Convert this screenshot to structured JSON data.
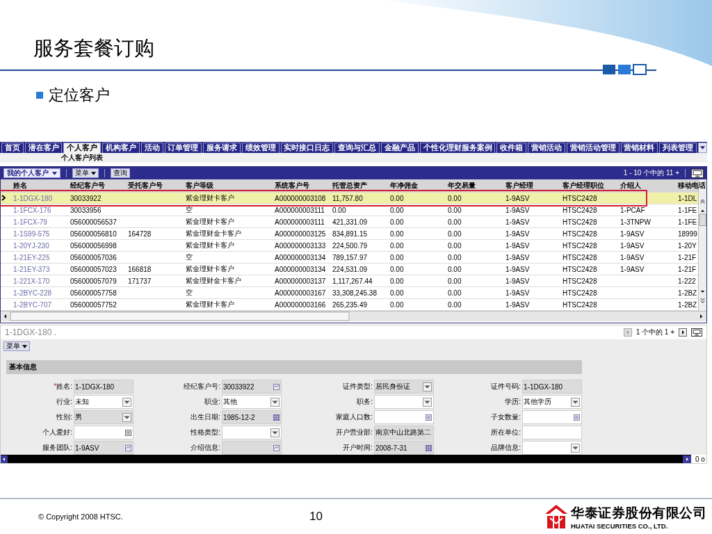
{
  "slide": {
    "title": "服务套餐订购",
    "bullet": "定位客户"
  },
  "app": {
    "tabs": [
      {
        "label": "首页",
        "selected": false
      },
      {
        "label": "潜在客户",
        "selected": false
      },
      {
        "label": "个人客户",
        "selected": true
      },
      {
        "label": "机构客户",
        "selected": false
      },
      {
        "label": "活动",
        "selected": false
      },
      {
        "label": "订单管理",
        "selected": false
      },
      {
        "label": "服务请求",
        "selected": false
      },
      {
        "label": "绩效管理",
        "selected": false
      },
      {
        "label": "实时接口日志",
        "selected": false
      },
      {
        "label": "查询与汇总",
        "selected": false
      },
      {
        "label": "金融产品",
        "selected": false
      },
      {
        "label": "个性化理财服务案例",
        "selected": false
      },
      {
        "label": "收件箱",
        "selected": false
      },
      {
        "label": "营销活动",
        "selected": false
      },
      {
        "label": "营销活动管理",
        "selected": false
      },
      {
        "label": "营销材料",
        "selected": false
      },
      {
        "label": "列表管理",
        "selected": false
      }
    ],
    "subtab": "个人客户列表",
    "list": {
      "query_menu": "我的个人客户",
      "menu_button": "菜单",
      "query_button": "查询",
      "pager": "1 - 10 个中的 11 +",
      "columns": [
        "姓名",
        "经纪客户号",
        "受托客户号",
        "客户等级",
        "系统客户号",
        "托管总资产",
        "年净佣金",
        "年交易量",
        "客户经理",
        "客户经理职位",
        "介绍人",
        "移动电话"
      ],
      "rows": [
        {
          "selected": true,
          "cells": [
            "1-1DGX-180",
            "30033922",
            "",
            "紫金理财卡客户",
            "A000000003108",
            "11,757.80",
            "0.00",
            "0.00",
            "1-9ASV",
            "HTSC2428",
            "",
            "1-1DL"
          ]
        },
        {
          "selected": false,
          "cells": [
            "1-1FCX-176",
            "30033956",
            "",
            "空",
            "A000000003111",
            "0.00",
            "0.00",
            "0.00",
            "1-9ASV",
            "HTSC2428",
            "1-PCAF",
            "1-1FE"
          ]
        },
        {
          "selected": false,
          "cells": [
            "1-1FCX-79",
            "056000056537",
            "",
            "紫金理财卡客户",
            "A000000003111",
            "421,331.09",
            "0.00",
            "0.00",
            "1-9ASV",
            "HTSC2428",
            "1-3TNPW",
            "1-1FE"
          ]
        },
        {
          "selected": false,
          "cells": [
            "1-1S99-575",
            "056000056810",
            "164728",
            "紫金理财金卡客户",
            "A000000003125",
            "834,891.15",
            "0.00",
            "0.00",
            "1-9ASV",
            "HTSC2428",
            "1-9ASV",
            "18999"
          ]
        },
        {
          "selected": false,
          "cells": [
            "1-20YJ-230",
            "056000056998",
            "",
            "紫金理财卡客户",
            "A000000003133",
            "224,500.79",
            "0.00",
            "0.00",
            "1-9ASV",
            "HTSC2428",
            "1-9ASV",
            "1-20Y"
          ]
        },
        {
          "selected": false,
          "cells": [
            "1-21EY-225",
            "056000057036",
            "",
            "空",
            "A000000003134",
            "789,157.97",
            "0.00",
            "0.00",
            "1-9ASV",
            "HTSC2428",
            "1-9ASV",
            "1-21F"
          ]
        },
        {
          "selected": false,
          "cells": [
            "1-21EY-373",
            "056000057023",
            "166818",
            "紫金理财卡客户",
            "A000000003134",
            "224,531.09",
            "0.00",
            "0.00",
            "1-9ASV",
            "HTSC2428",
            "1-9ASV",
            "1-21F"
          ]
        },
        {
          "selected": false,
          "cells": [
            "1-221X-170",
            "056000057079",
            "171737",
            "紫金理财金卡客户",
            "A000000003137",
            "1,117,267.44",
            "0.00",
            "0.00",
            "1-9ASV",
            "HTSC2428",
            "",
            "1-222"
          ]
        },
        {
          "selected": false,
          "cells": [
            "1-2BYC-228",
            "056000057758",
            "",
            "空",
            "A000000003167",
            "33,308,245.38",
            "0.00",
            "0.00",
            "1-9ASV",
            "HTSC2428",
            "",
            "1-2BZ"
          ]
        },
        {
          "selected": false,
          "cells": [
            "1-2BYC-707",
            "056000057752",
            "",
            "紫金理财卡客户",
            "A000000003166",
            "265,235.49",
            "0.00",
            "0.00",
            "1-9ASV",
            "HTSC2428",
            "",
            "1-2BZ"
          ]
        }
      ]
    },
    "detail": {
      "record": "1-1DGX-180 .",
      "pager": "1 个中的 1 +",
      "menu_button": "菜单",
      "section": "基本信息",
      "fields": [
        {
          "label": "*姓名:",
          "required": true,
          "value": "1-1DGX-180",
          "kind": "text",
          "readonly": true
        },
        {
          "label": "经纪客户号:",
          "required": false,
          "value": "30033922",
          "kind": "lookup",
          "readonly": true
        },
        {
          "label": "证件类型:",
          "required": false,
          "value": "居民身份证",
          "kind": "select",
          "readonly": true
        },
        {
          "label": "证件号码:",
          "required": false,
          "value": "1-1DGX-180",
          "kind": "text",
          "readonly": true
        },
        {
          "label": "行业:",
          "required": false,
          "value": "未知",
          "kind": "select",
          "readonly": false
        },
        {
          "label": "职业:",
          "required": false,
          "value": "其他",
          "kind": "select",
          "readonly": false
        },
        {
          "label": "职务:",
          "required": false,
          "kind": "select",
          "readonly": false
        },
        {
          "label": "学历:",
          "required": false,
          "value": "其他学历",
          "kind": "select",
          "readonly": false
        },
        {
          "label": "性别:",
          "required": false,
          "value": "男",
          "kind": "select",
          "readonly": true
        },
        {
          "label": "出生日期:",
          "required": false,
          "value": "1985-12-2",
          "kind": "calendar",
          "readonly": true
        },
        {
          "label": "家庭人口数:",
          "required": false,
          "kind": "number",
          "readonly": false
        },
        {
          "label": "子女数量:",
          "required": false,
          "kind": "number",
          "readonly": false
        },
        {
          "label": "个人爱好:",
          "required": false,
          "kind": "note",
          "readonly": false
        },
        {
          "label": "性格类型:",
          "required": false,
          "kind": "select",
          "readonly": false
        },
        {
          "label": "开户营业部:",
          "required": false,
          "value": "南京中山北路第二",
          "kind": "text",
          "readonly": true
        },
        {
          "label": "所在单位:",
          "required": false,
          "kind": "text",
          "readonly": false
        },
        {
          "label": "服务团队:",
          "required": false,
          "value": "1-9ASV",
          "kind": "lookup",
          "readonly": true
        },
        {
          "label": "介绍信息:",
          "required": false,
          "kind": "lookup",
          "readonly": true
        },
        {
          "label": "开户时间:",
          "required": false,
          "value": "2008-7-31",
          "kind": "calendar",
          "readonly": true
        },
        {
          "label": "品牌信息:",
          "required": false,
          "kind": "select",
          "readonly": false
        }
      ]
    },
    "status": "0 o"
  },
  "footer": {
    "copyright": "© Copyright 2008 HTSC.",
    "page": "10",
    "company": "华泰证券股份有限公司",
    "company_en": "HUATAI SECURITIES CO., LTD."
  }
}
